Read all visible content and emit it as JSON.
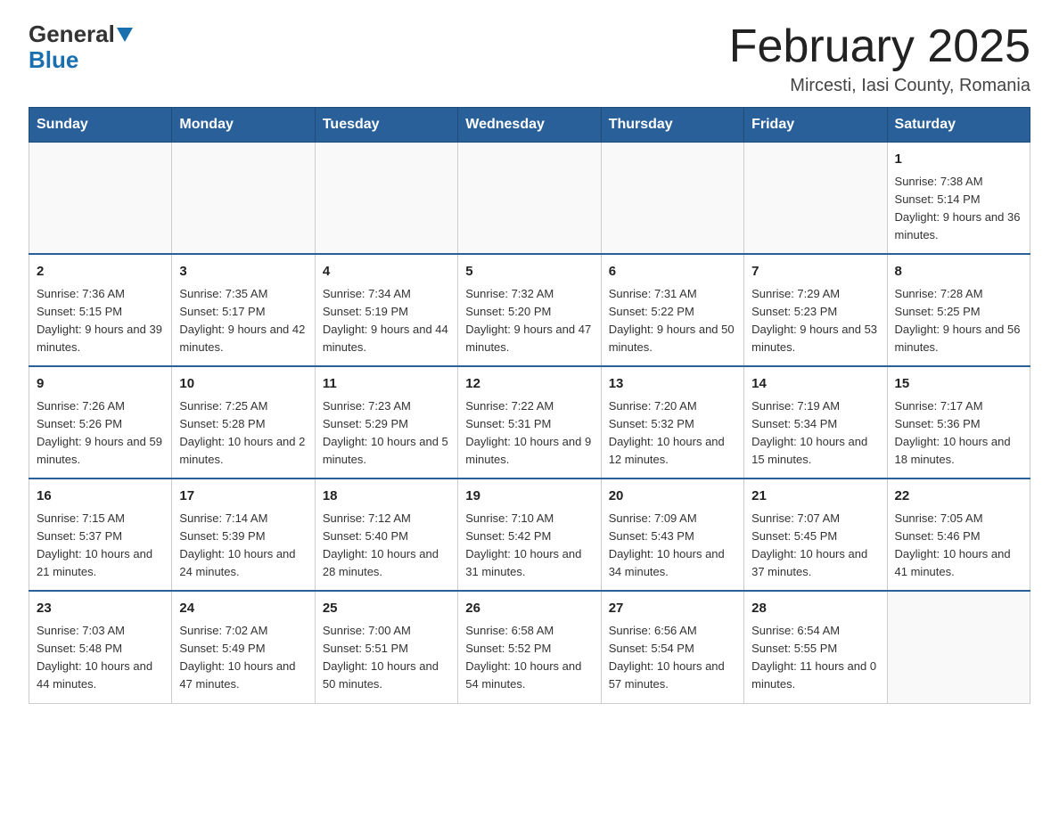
{
  "header": {
    "logo_general": "General",
    "logo_blue": "Blue",
    "month_title": "February 2025",
    "location": "Mircesti, Iasi County, Romania"
  },
  "weekdays": [
    "Sunday",
    "Monday",
    "Tuesday",
    "Wednesday",
    "Thursday",
    "Friday",
    "Saturday"
  ],
  "weeks": [
    [
      {
        "day": "",
        "info": ""
      },
      {
        "day": "",
        "info": ""
      },
      {
        "day": "",
        "info": ""
      },
      {
        "day": "",
        "info": ""
      },
      {
        "day": "",
        "info": ""
      },
      {
        "day": "",
        "info": ""
      },
      {
        "day": "1",
        "info": "Sunrise: 7:38 AM\nSunset: 5:14 PM\nDaylight: 9 hours and 36 minutes."
      }
    ],
    [
      {
        "day": "2",
        "info": "Sunrise: 7:36 AM\nSunset: 5:15 PM\nDaylight: 9 hours and 39 minutes."
      },
      {
        "day": "3",
        "info": "Sunrise: 7:35 AM\nSunset: 5:17 PM\nDaylight: 9 hours and 42 minutes."
      },
      {
        "day": "4",
        "info": "Sunrise: 7:34 AM\nSunset: 5:19 PM\nDaylight: 9 hours and 44 minutes."
      },
      {
        "day": "5",
        "info": "Sunrise: 7:32 AM\nSunset: 5:20 PM\nDaylight: 9 hours and 47 minutes."
      },
      {
        "day": "6",
        "info": "Sunrise: 7:31 AM\nSunset: 5:22 PM\nDaylight: 9 hours and 50 minutes."
      },
      {
        "day": "7",
        "info": "Sunrise: 7:29 AM\nSunset: 5:23 PM\nDaylight: 9 hours and 53 minutes."
      },
      {
        "day": "8",
        "info": "Sunrise: 7:28 AM\nSunset: 5:25 PM\nDaylight: 9 hours and 56 minutes."
      }
    ],
    [
      {
        "day": "9",
        "info": "Sunrise: 7:26 AM\nSunset: 5:26 PM\nDaylight: 9 hours and 59 minutes."
      },
      {
        "day": "10",
        "info": "Sunrise: 7:25 AM\nSunset: 5:28 PM\nDaylight: 10 hours and 2 minutes."
      },
      {
        "day": "11",
        "info": "Sunrise: 7:23 AM\nSunset: 5:29 PM\nDaylight: 10 hours and 5 minutes."
      },
      {
        "day": "12",
        "info": "Sunrise: 7:22 AM\nSunset: 5:31 PM\nDaylight: 10 hours and 9 minutes."
      },
      {
        "day": "13",
        "info": "Sunrise: 7:20 AM\nSunset: 5:32 PM\nDaylight: 10 hours and 12 minutes."
      },
      {
        "day": "14",
        "info": "Sunrise: 7:19 AM\nSunset: 5:34 PM\nDaylight: 10 hours and 15 minutes."
      },
      {
        "day": "15",
        "info": "Sunrise: 7:17 AM\nSunset: 5:36 PM\nDaylight: 10 hours and 18 minutes."
      }
    ],
    [
      {
        "day": "16",
        "info": "Sunrise: 7:15 AM\nSunset: 5:37 PM\nDaylight: 10 hours and 21 minutes."
      },
      {
        "day": "17",
        "info": "Sunrise: 7:14 AM\nSunset: 5:39 PM\nDaylight: 10 hours and 24 minutes."
      },
      {
        "day": "18",
        "info": "Sunrise: 7:12 AM\nSunset: 5:40 PM\nDaylight: 10 hours and 28 minutes."
      },
      {
        "day": "19",
        "info": "Sunrise: 7:10 AM\nSunset: 5:42 PM\nDaylight: 10 hours and 31 minutes."
      },
      {
        "day": "20",
        "info": "Sunrise: 7:09 AM\nSunset: 5:43 PM\nDaylight: 10 hours and 34 minutes."
      },
      {
        "day": "21",
        "info": "Sunrise: 7:07 AM\nSunset: 5:45 PM\nDaylight: 10 hours and 37 minutes."
      },
      {
        "day": "22",
        "info": "Sunrise: 7:05 AM\nSunset: 5:46 PM\nDaylight: 10 hours and 41 minutes."
      }
    ],
    [
      {
        "day": "23",
        "info": "Sunrise: 7:03 AM\nSunset: 5:48 PM\nDaylight: 10 hours and 44 minutes."
      },
      {
        "day": "24",
        "info": "Sunrise: 7:02 AM\nSunset: 5:49 PM\nDaylight: 10 hours and 47 minutes."
      },
      {
        "day": "25",
        "info": "Sunrise: 7:00 AM\nSunset: 5:51 PM\nDaylight: 10 hours and 50 minutes."
      },
      {
        "day": "26",
        "info": "Sunrise: 6:58 AM\nSunset: 5:52 PM\nDaylight: 10 hours and 54 minutes."
      },
      {
        "day": "27",
        "info": "Sunrise: 6:56 AM\nSunset: 5:54 PM\nDaylight: 10 hours and 57 minutes."
      },
      {
        "day": "28",
        "info": "Sunrise: 6:54 AM\nSunset: 5:55 PM\nDaylight: 11 hours and 0 minutes."
      },
      {
        "day": "",
        "info": ""
      }
    ]
  ]
}
